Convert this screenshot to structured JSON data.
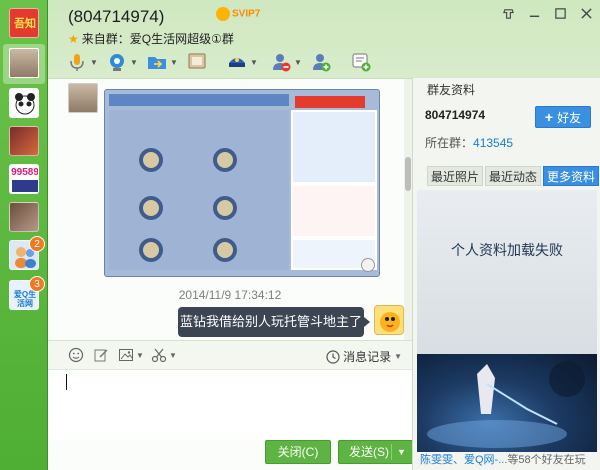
{
  "header": {
    "title": "(804714974)",
    "vip_badge": "SVIP7",
    "subtitle": "来自群：爱Q生活网超级①群"
  },
  "contacts": [
    {
      "name": "group-logo",
      "label": "吾知"
    },
    {
      "name": "face-avatar"
    },
    {
      "name": "panda-avatar"
    },
    {
      "name": "anime-avatar"
    },
    {
      "name": "number-avatar",
      "label": "99589"
    },
    {
      "name": "girl-avatar"
    },
    {
      "name": "people-avatar",
      "badge": "2"
    },
    {
      "name": "life-avatar",
      "label": "爱Q生活网",
      "badge": "3"
    }
  ],
  "chat": {
    "timestamp": "2014/11/9 17:34:12",
    "message": "蓝钻我借给别人玩托管斗地主了"
  },
  "input_tools": {
    "history_label": "消息记录"
  },
  "footer": {
    "close_label": "关闭(C)",
    "send_label": "发送(S)"
  },
  "right_panel": {
    "title": "群友资料",
    "qq_number": "804714974",
    "add_friend_label": "好友",
    "in_group_label": "所在群：",
    "in_group_number": "413545",
    "tabs": [
      "最近照片",
      "最近动态",
      "更多资料"
    ],
    "active_tab": 2,
    "fail_text": "个人资料加载失败",
    "ad_caption_blue": "陈雯雯、爱Q网-...",
    "ad_caption_gray": "等58个好友在玩"
  },
  "colors": {
    "brand_green": "#5eb442",
    "accent_blue": "#3a8fe0",
    "badge_orange": "#f07a21",
    "bubble_dark": "#3c4552"
  }
}
